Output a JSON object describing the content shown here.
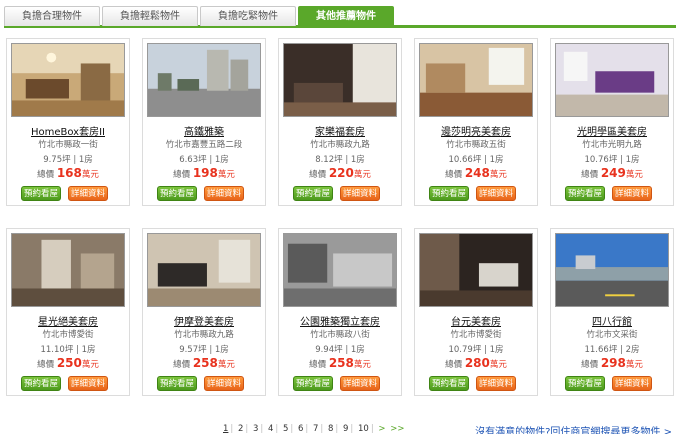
{
  "tabs": [
    {
      "label": "負擔合理物件",
      "active": false
    },
    {
      "label": "負擔輕鬆物件",
      "active": false
    },
    {
      "label": "負擔吃緊物件",
      "active": false
    },
    {
      "label": "其他推薦物件",
      "active": true
    }
  ],
  "buttons": {
    "view": "預約看屋",
    "detail": "詳細資料"
  },
  "price_prefix": "總價",
  "price_unit": "萬元",
  "listings": [
    {
      "title": "HomeBox套房II",
      "address": "竹北市縣政一街",
      "size": "9.75坪 | 1房",
      "price": "168"
    },
    {
      "title": "高鐵雅築",
      "address": "竹北市嘉豐五路二段",
      "size": "6.63坪 | 1房",
      "price": "198"
    },
    {
      "title": "家樂福套房",
      "address": "竹北市縣政九路",
      "size": "8.12坪 | 1房",
      "price": "220"
    },
    {
      "title": "邊莎明亮美套房",
      "address": "竹北市縣政五街",
      "size": "10.66坪 | 1房",
      "price": "248"
    },
    {
      "title": "光明學區美套房",
      "address": "竹北市光明九路",
      "size": "10.76坪 | 1房",
      "price": "249"
    },
    {
      "title": "星光絕美套房",
      "address": "竹北市博愛街",
      "size": "11.10坪 | 1房",
      "price": "250"
    },
    {
      "title": "伊摩登美套房",
      "address": "竹北市縣政九路",
      "size": "9.57坪 | 1房",
      "price": "258"
    },
    {
      "title": "公園雅築獨立套房",
      "address": "竹北市縣政八街",
      "size": "9.94坪 | 1房",
      "price": "258"
    },
    {
      "title": "台元美套房",
      "address": "竹北市博愛街",
      "size": "10.79坪 | 1房",
      "price": "280"
    },
    {
      "title": "四八行館",
      "address": "竹北市文采街",
      "size": "11.66坪 | 2房",
      "price": "298"
    }
  ],
  "pagination": {
    "pages": [
      "1",
      "2",
      "3",
      "4",
      "5",
      "6",
      "7",
      "8",
      "9",
      "10"
    ],
    "current": "1",
    "next": ">",
    "last": ">>"
  },
  "more_link": "沒有滿意的物件?回住商官網搜尋更多物件 >"
}
